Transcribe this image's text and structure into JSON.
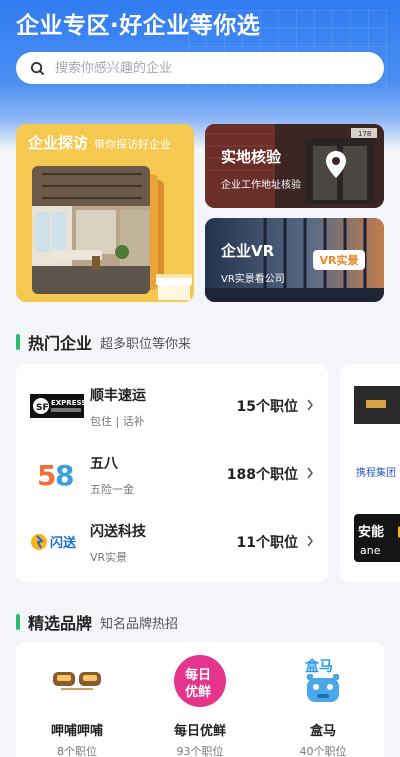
{
  "header": {
    "title": "企业专区·好企业等你选"
  },
  "search": {
    "placeholder": "搜索你感兴趣的企业",
    "icon": "search-icon"
  },
  "features": {
    "visit": {
      "title": "企业探访",
      "subtitle": "带你探访好企业"
    },
    "verify": {
      "title": "实地核验",
      "subtitle": "企业工作地址核验",
      "icon": "location-pin-icon"
    },
    "vr": {
      "title": "企业VR",
      "subtitle": "VR实景看公司",
      "badge": "VR实景"
    }
  },
  "hot_companies": {
    "title": "热门企业",
    "subtitle": "超多职位等你来",
    "items": [
      {
        "name": "顺丰速运",
        "tags": "包住 | 话补",
        "count": "15个职位",
        "logo_text": "EXPRESS"
      },
      {
        "name": "五八",
        "tags": "五险一金",
        "count": "188个职位",
        "logo_text": "58"
      },
      {
        "name": "闪送科技",
        "tags": "VR实景",
        "count": "11个职位",
        "logo_text": "闪送"
      }
    ],
    "side_logos": [
      "携程集团",
      "安能",
      "ane"
    ]
  },
  "brands": {
    "title": "精选品牌",
    "subtitle": "知名品牌热招",
    "items": [
      {
        "name": "呷哺呷哺",
        "count": "8个职位"
      },
      {
        "name": "每日优鲜",
        "count": "93个职位",
        "logo_top": "每日",
        "logo_bottom": "优鲜"
      },
      {
        "name": "盒马",
        "count": "40个职位",
        "logo_text": "盒马"
      }
    ]
  },
  "colors": {
    "primary_blue": "#2f7bf0",
    "accent_green": "#2dbf6b",
    "visit_yellow": "#f5c84f",
    "freshippo_pink": "#e4348b"
  }
}
